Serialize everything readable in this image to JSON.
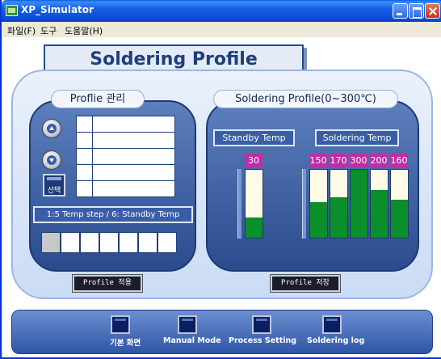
{
  "window": {
    "title": "XP_Simulator",
    "menu": [
      "파일(F)",
      "도구",
      "도움말(H)"
    ]
  },
  "header": {
    "title": "Soldering Profile"
  },
  "profile_panel": {
    "title": "Proflie 관리",
    "select_label": "선택",
    "table_rows": 5,
    "step_caption": "1:5 Temp step / 6: Standby Temp",
    "step_cells": 7,
    "active_step_cell": 1
  },
  "soldering_panel": {
    "title": "Soldering Profile(0~300℃)",
    "standby_label": "Standby Temp",
    "soldering_label": "Soldering Temp",
    "max_temp": 300,
    "standby": {
      "value": "30",
      "level": 0.3
    },
    "soldering_values": [
      "150",
      "170",
      "300",
      "200",
      "160"
    ],
    "soldering_levels": [
      0.52,
      0.6,
      1.0,
      0.7,
      0.56
    ]
  },
  "actions": {
    "apply_label": "Profile 적용",
    "save_label": "Profile 저장"
  },
  "nav": {
    "items": [
      "기본 화면",
      "Manual Mode",
      "Process Setting",
      "Soldering log"
    ]
  },
  "colors": {
    "bar_fill": "#0a8f2a",
    "value_box": "#c02ea6",
    "panel_dark": "#2a4b8c"
  }
}
